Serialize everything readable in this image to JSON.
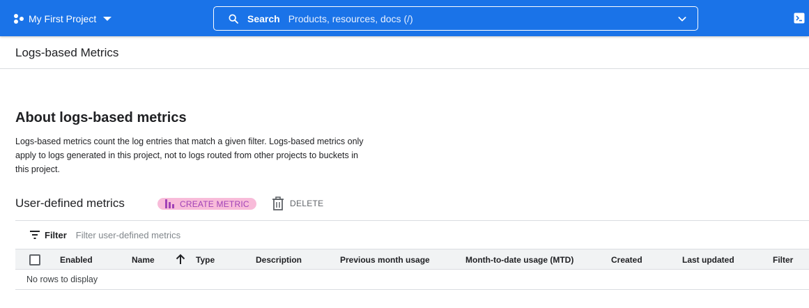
{
  "topbar": {
    "project_name": "My First Project",
    "search_label": "Search",
    "search_placeholder": "Products, resources, docs (/)"
  },
  "page": {
    "title": "Logs-based Metrics"
  },
  "about": {
    "title": "About logs-based metrics",
    "text": "Logs-based metrics count the log entries that match a given filter. Logs-based metrics only apply to logs generated in this project, not to logs routed from other projects to buckets in this project."
  },
  "user_defined": {
    "title": "User-defined metrics",
    "create_label": "CREATE METRIC",
    "delete_label": "DELETE"
  },
  "filter": {
    "label": "Filter",
    "placeholder": "Filter user-defined metrics"
  },
  "table": {
    "columns": [
      "Enabled",
      "Name",
      "Type",
      "Description",
      "Previous month usage",
      "Month-to-date usage (MTD)",
      "Created",
      "Last updated",
      "Filter"
    ],
    "empty_text": "No rows to display"
  },
  "colors": {
    "topbar": "#1a73e8",
    "create_highlight": "#f8bbd9",
    "create_text": "#a142b7"
  }
}
